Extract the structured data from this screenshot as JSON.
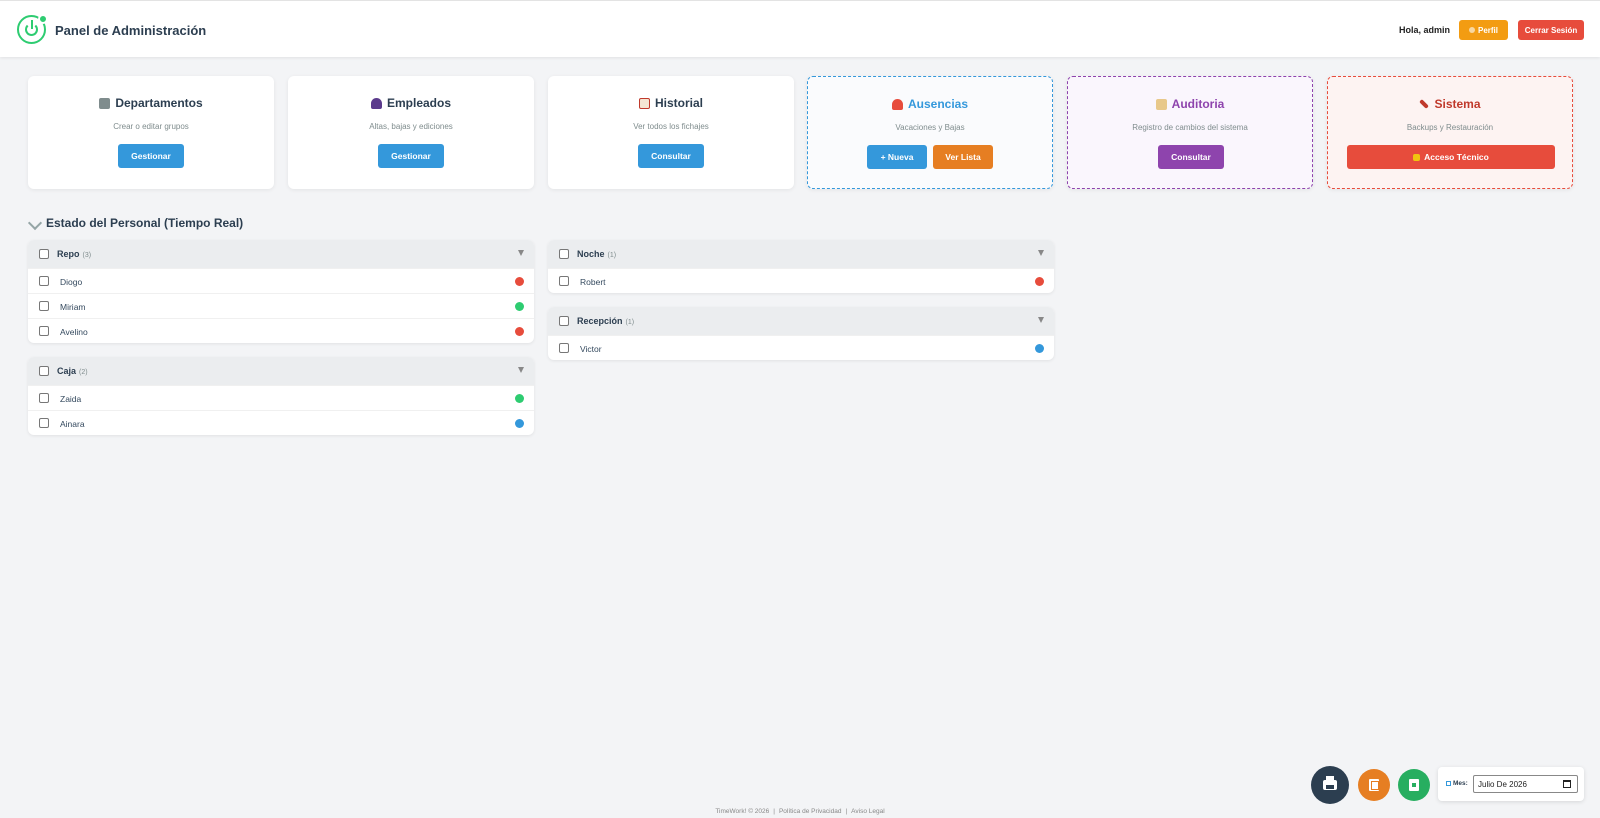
{
  "header": {
    "title": "Panel de Administración",
    "greeting": "Hola, admin",
    "profile_label": "Perfil",
    "logout_label": "Cerrar Sesión"
  },
  "cards": [
    {
      "title": "Departamentos",
      "subtitle": "Crear o editar grupos",
      "icon": "building-icon",
      "buttons": [
        {
          "label": "Gestionar",
          "color": "#3498db"
        }
      ]
    },
    {
      "title": "Empleados",
      "subtitle": "Altas, bajas y ediciones",
      "icon": "user-icon",
      "buttons": [
        {
          "label": "Gestionar",
          "color": "#3498db"
        }
      ]
    },
    {
      "title": "Historial",
      "subtitle": "Ver todos los fichajes",
      "icon": "clipboard-icon",
      "buttons": [
        {
          "label": "Consultar",
          "color": "#3498db"
        }
      ]
    },
    {
      "title": "Ausencias",
      "subtitle": "Vacaciones y Bajas",
      "icon": "beach-icon",
      "accent": "#3498db",
      "buttons": [
        {
          "label": "+ Nueva",
          "color": "#3498db"
        },
        {
          "label": "Ver Lista",
          "color": "#e67e22"
        }
      ]
    },
    {
      "title": "Auditoria",
      "subtitle": "Registro de cambios del sistema",
      "icon": "scroll-icon",
      "accent": "#8e44ad",
      "buttons": [
        {
          "label": "Consultar",
          "color": "#8e44ad"
        }
      ]
    },
    {
      "title": "Sistema",
      "subtitle": "Backups y Restauración",
      "icon": "tools-icon",
      "accent": "#e74c3c",
      "buttons": [
        {
          "label": "Acceso Técnico",
          "color": "#e74c3c"
        }
      ]
    }
  ],
  "section": {
    "title": "Estado del Personal (Tiempo Real)"
  },
  "groups": [
    {
      "name": "Repo",
      "count": "(3)",
      "members": [
        {
          "name": "Diogo",
          "status": "#e74c3c"
        },
        {
          "name": "Miriam",
          "status": "#2ecc71"
        },
        {
          "name": "Avelino",
          "status": "#e74c3c"
        }
      ]
    },
    {
      "name": "Caja",
      "count": "(2)",
      "members": [
        {
          "name": "Zaida",
          "status": "#2ecc71"
        },
        {
          "name": "Ainara",
          "status": "#3498db"
        }
      ]
    },
    {
      "name": "Noche",
      "count": "(1)",
      "members": [
        {
          "name": "Robert",
          "status": "#e74c3c"
        }
      ]
    },
    {
      "name": "Recepción",
      "count": "(1)",
      "members": [
        {
          "name": "Victor",
          "status": "#3498db"
        }
      ]
    }
  ],
  "tools": {
    "month_label": "Mes:",
    "month_value": "Julio De 2026"
  },
  "footer": {
    "copyright": "TimeWork! © 2026",
    "privacy": "Política de Privacidad",
    "legal": "Aviso Legal"
  }
}
